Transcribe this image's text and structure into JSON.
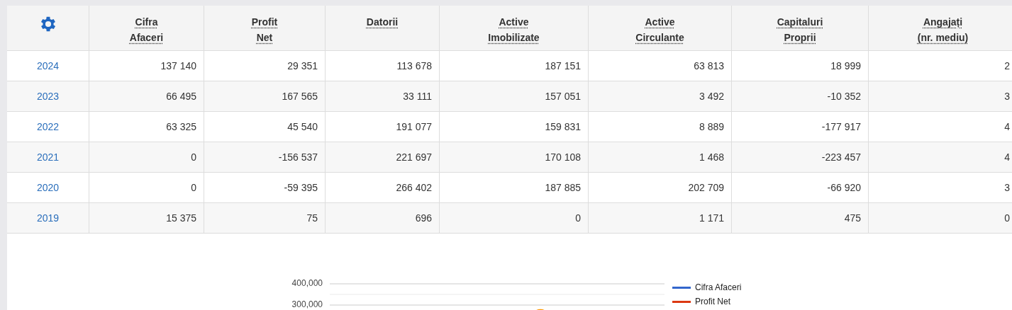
{
  "table": {
    "columns": [
      {
        "label": "Cifra\nAfaceri"
      },
      {
        "label": "Profit\nNet"
      },
      {
        "label": "Datorii"
      },
      {
        "label": "Active\nImobilizate"
      },
      {
        "label": "Active\nCirculante"
      },
      {
        "label": "Capitaluri\nProprii"
      },
      {
        "label": "Angajați\n(nr. mediu)"
      }
    ],
    "rows": [
      {
        "year": "2024",
        "values": [
          "137 140",
          "29 351",
          "113 678",
          "187 151",
          "63 813",
          "18 999",
          "2"
        ]
      },
      {
        "year": "2023",
        "values": [
          "66 495",
          "167 565",
          "33 111",
          "157 051",
          "3 492",
          "-10 352",
          "3"
        ]
      },
      {
        "year": "2022",
        "values": [
          "63 325",
          "45 540",
          "191 077",
          "159 831",
          "8 889",
          "-177 917",
          "4"
        ]
      },
      {
        "year": "2021",
        "values": [
          "0",
          "-156 537",
          "221 697",
          "170 108",
          "1 468",
          "-223 457",
          "4"
        ]
      },
      {
        "year": "2020",
        "values": [
          "0",
          "-59 395",
          "266 402",
          "187 885",
          "202 709",
          "-66 920",
          "3"
        ]
      },
      {
        "year": "2019",
        "values": [
          "15 375",
          "75",
          "696",
          "0",
          "1 171",
          "475",
          "0"
        ]
      }
    ]
  },
  "chart": {
    "y_axis_labels": [
      "400,000",
      "300,000"
    ],
    "legend": [
      {
        "label": "Cifra Afaceri",
        "color": "#3366cc"
      },
      {
        "label": "Profit Net",
        "color": "#dc3912"
      }
    ]
  }
}
